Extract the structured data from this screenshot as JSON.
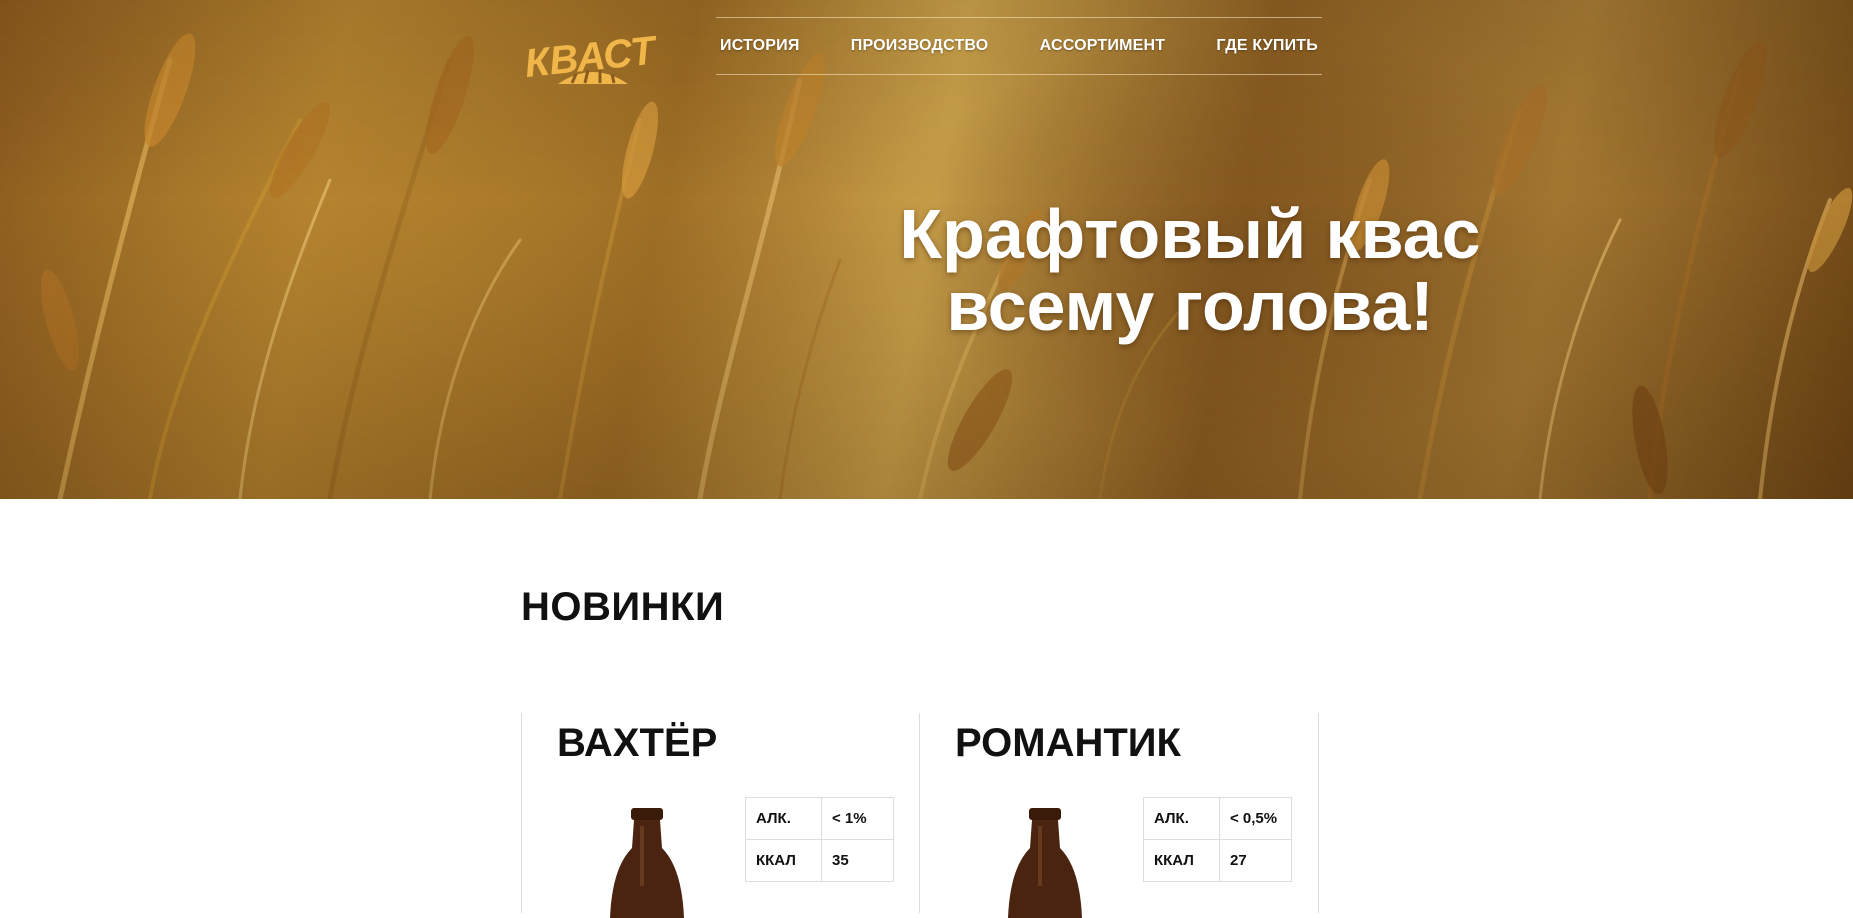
{
  "brand": {
    "logo_text": "КВАСТ"
  },
  "nav": {
    "items": [
      {
        "label": "ИСТОРИЯ"
      },
      {
        "label": "ПРОИЗВОДСТВО"
      },
      {
        "label": "АССОРТИМЕНТ"
      },
      {
        "label": "ГДЕ КУПИТЬ"
      }
    ]
  },
  "hero": {
    "title_line1": "Крафтовый квас",
    "title_line2": "всему голова!"
  },
  "new_section": {
    "title": "НОВИНКИ",
    "products": [
      {
        "name": "ВАХТЁР",
        "specs": [
          {
            "label": "АЛК.",
            "value": "< 1%"
          },
          {
            "label": "ККАЛ",
            "value": "35"
          }
        ]
      },
      {
        "name": "РОМАНТИК",
        "specs": [
          {
            "label": "АЛК.",
            "value": "< 0,5%"
          },
          {
            "label": "ККАЛ",
            "value": "27"
          }
        ]
      }
    ]
  },
  "colors": {
    "logo": "#f0b64a",
    "text_dark": "#111111",
    "hero_text": "#ffffff",
    "divider": "#dddddd",
    "bottle": "#4a2410"
  }
}
